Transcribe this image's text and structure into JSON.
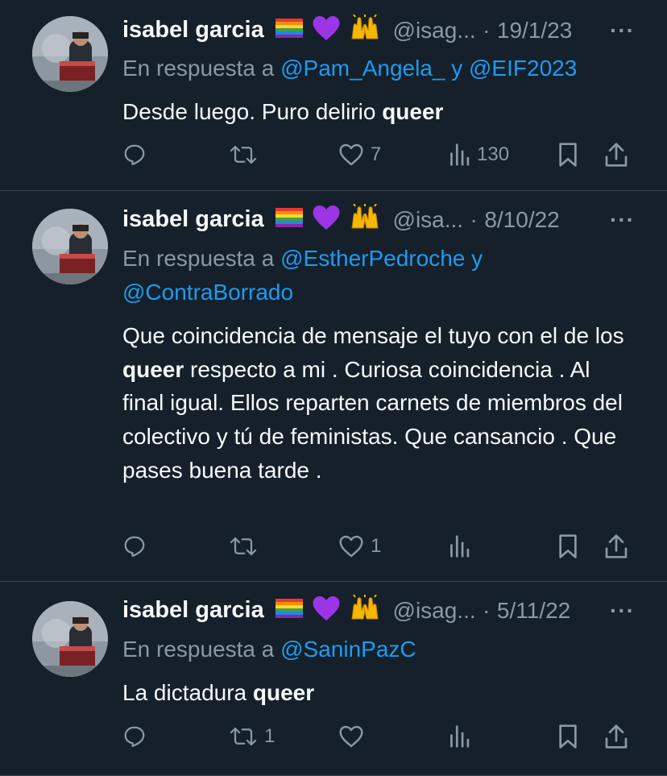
{
  "tweets": [
    {
      "name": "isabel garcia",
      "handle": "@isag...",
      "date": "19/1/23",
      "reply_prefix": "En respuesta a ",
      "reply_mentions": "@Pam_Angela_ y @EIF2023",
      "reply_line2": "",
      "text_before": "Desde luego. Puro delirio ",
      "text_bold": "queer",
      "text_after": "",
      "replies": "",
      "retweets": "",
      "likes": "7",
      "views": "130"
    },
    {
      "name": "isabel garcia",
      "handle": "@isa...",
      "date": "8/10/22",
      "reply_prefix": "En respuesta a ",
      "reply_mentions": "@EstherPedroche y",
      "reply_line2": "@ContraBorrado",
      "text_before": "Que coincidencia de mensaje el tuyo con el de los ",
      "text_bold": "queer",
      "text_after": " respecto a mi . Curiosa coincidencia . Al final igual. Ellos reparten carnets de miembros del colectivo y tú de feministas. Que cansancio . Que pases buena tarde .",
      "replies": "",
      "retweets": "",
      "likes": "1",
      "views": ""
    },
    {
      "name": "isabel garcia",
      "handle": "@isag...",
      "date": "5/11/22",
      "reply_prefix": "En respuesta a ",
      "reply_mentions": "@SaninPazC",
      "reply_line2": "",
      "text_before": "La dictadura ",
      "text_bold": "queer",
      "text_after": "",
      "replies": "",
      "retweets": "1",
      "likes": "",
      "views": ""
    }
  ],
  "icons": {
    "badges": [
      "rainbow-flag-icon",
      "purple-heart-icon",
      "raised-hands-icon"
    ],
    "more": "more-icon",
    "reply": "reply-icon",
    "retweet": "retweet-icon",
    "like": "like-icon",
    "views": "views-icon",
    "bookmark": "bookmark-icon",
    "share": "share-icon"
  },
  "colors": {
    "background": "#15202b",
    "text": "#f7f9f9",
    "secondary": "#8b98a5",
    "link": "#1d9bf0",
    "divider": "#38444d"
  }
}
